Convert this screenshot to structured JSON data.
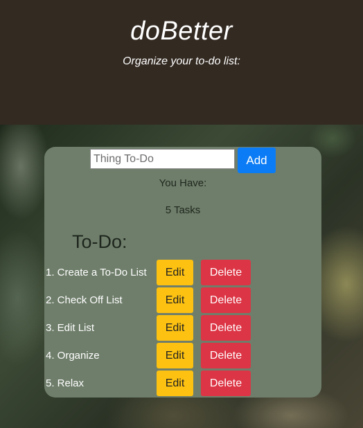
{
  "header": {
    "title": "doBetter",
    "subtitle": "Organize your to-do list:"
  },
  "form": {
    "placeholder": "Thing To-Do",
    "add_label": "Add"
  },
  "summary": {
    "you_have": "You Have:",
    "count_text": "5 Tasks"
  },
  "list": {
    "heading": "To-Do:",
    "items": [
      {
        "label": "1. Create a To-Do List",
        "edit": "Edit",
        "delete": "Delete"
      },
      {
        "label": "2. Check Off List",
        "edit": "Edit",
        "delete": "Delete"
      },
      {
        "label": "3. Edit List",
        "edit": "Edit",
        "delete": "Delete"
      },
      {
        "label": "4. Organize",
        "edit": "Edit",
        "delete": "Delete"
      },
      {
        "label": "5. Relax",
        "edit": "Edit",
        "delete": "Delete"
      }
    ]
  },
  "colors": {
    "header_bg": "#332a22",
    "card_bg": "#6f7e6b",
    "add_button": "#0b7cf5",
    "edit_button": "#fcc111",
    "delete_button": "#dc3545"
  }
}
